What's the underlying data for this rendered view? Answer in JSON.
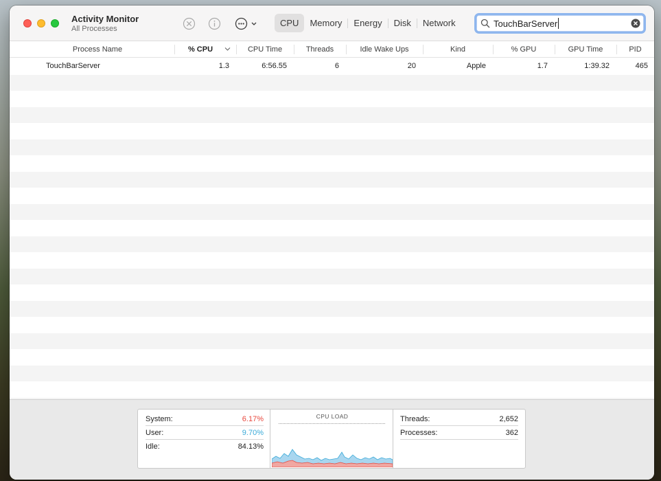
{
  "app": {
    "title": "Activity Monitor",
    "subtitle": "All Processes"
  },
  "tabs": [
    {
      "label": "CPU",
      "active": true
    },
    {
      "label": "Memory",
      "active": false
    },
    {
      "label": "Energy",
      "active": false
    },
    {
      "label": "Disk",
      "active": false
    },
    {
      "label": "Network",
      "active": false
    }
  ],
  "search": {
    "value": "TouchBarServer"
  },
  "columns": {
    "process_name": "Process Name",
    "cpu_pct": "% CPU",
    "cpu_time": "CPU Time",
    "threads": "Threads",
    "idle_wake_ups": "Idle Wake Ups",
    "kind": "Kind",
    "gpu_pct": "% GPU",
    "gpu_time": "GPU Time",
    "pid": "PID"
  },
  "processes": [
    {
      "name": "TouchBarServer",
      "cpu_pct": "1.3",
      "cpu_time": "6:56.55",
      "threads": "6",
      "idle_wake_ups": "20",
      "kind": "Apple",
      "gpu_pct": "1.7",
      "gpu_time": "1:39.32",
      "pid": "465"
    }
  ],
  "footer": {
    "system_label": "System:",
    "system_value": "6.17%",
    "user_label": "User:",
    "user_value": "9.70%",
    "idle_label": "Idle:",
    "idle_value": "84.13%",
    "graph_title": "CPU LOAD",
    "threads_label": "Threads:",
    "threads_value": "2,652",
    "processes_label": "Processes:",
    "processes_value": "362"
  },
  "colors": {
    "system": "#e8483e",
    "user": "#3aaad8",
    "search_focus": "#8eb6ee",
    "active_tab": "#e1e0e0"
  },
  "icons": {
    "stop": "x-circle-icon",
    "info": "info-circle-icon",
    "more": "ellipsis-circle-icon",
    "search": "magnifier-icon",
    "clear": "x-circle-filled-icon"
  }
}
